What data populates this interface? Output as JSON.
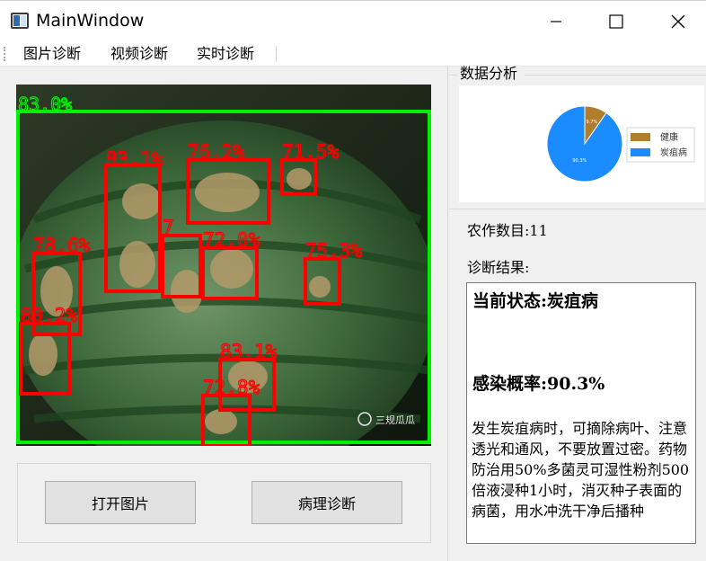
{
  "window": {
    "title": "MainWindow"
  },
  "menu": {
    "items": [
      "图片诊断",
      "视频诊断",
      "实时诊断"
    ]
  },
  "image": {
    "overall_label": "83.0%",
    "detections": [
      "83.1%",
      "76.2%",
      "71.5%",
      "78.6%",
      "7",
      "72.0%",
      "75.3%",
      "80.2%",
      "83.1%",
      "72.8%"
    ],
    "watermark": "三规瓜瓜"
  },
  "buttons": {
    "open": "打开图片",
    "diagnose": "病理诊断"
  },
  "analysis": {
    "group_title": "数据分析",
    "crop_count_label": "农作数目:11",
    "result_label": "诊断结果:"
  },
  "chart_data": {
    "type": "pie",
    "labels": [
      "健康",
      "炭疽病"
    ],
    "values": [
      9.7,
      90.3
    ],
    "data_labels": [
      "9.7%",
      "90.3%"
    ],
    "colors": [
      "#b07d2e",
      "#1a8cff"
    ],
    "legend_position": "right"
  },
  "result": {
    "status": "当前状态:炭疽病",
    "probability": "感染概率:90.3%",
    "advice": "发生炭疽病时，可摘除病叶、注意透光和通风，不要放置过密。药物防治用50%多菌灵可湿性粉剂500倍液浸种1小时，消灭种子表面的病菌，用水冲洗干净后播种"
  }
}
